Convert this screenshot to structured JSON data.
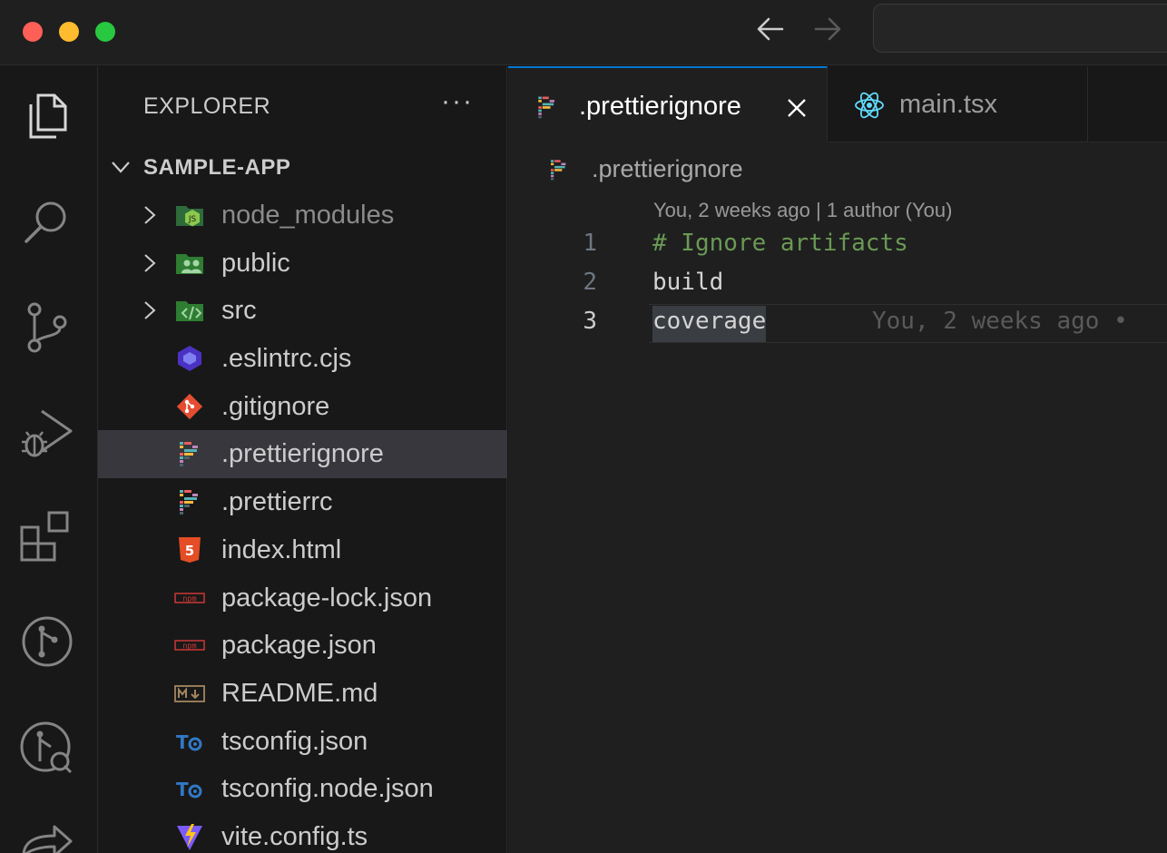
{
  "titlebar": {
    "back_icon": "arrow-left-icon",
    "forward_icon": "arrow-right-icon"
  },
  "activity_bar": [
    {
      "name": "explorer-icon"
    },
    {
      "name": "search-icon"
    },
    {
      "name": "source-control-icon"
    },
    {
      "name": "run-debug-icon"
    },
    {
      "name": "extensions-icon"
    },
    {
      "name": "git-graph-icon"
    },
    {
      "name": "timeline-icon"
    },
    {
      "name": "remote-icon"
    }
  ],
  "sidebar": {
    "title": "EXPLORER",
    "more": "···",
    "root": "SAMPLE-APP",
    "items": [
      {
        "label": "node_modules",
        "type": "folder",
        "icon": "node-folder-icon",
        "color": "#8cc84b",
        "dim": true
      },
      {
        "label": "public",
        "type": "folder",
        "icon": "public-folder-icon",
        "color": "#4caf50"
      },
      {
        "label": "src",
        "type": "folder",
        "icon": "src-folder-icon",
        "color": "#4caf50"
      },
      {
        "label": ".eslintrc.cjs",
        "type": "file",
        "icon": "eslint-icon",
        "color": "#4b32c3"
      },
      {
        "label": ".gitignore",
        "type": "file",
        "icon": "git-icon",
        "color": "#e44d31"
      },
      {
        "label": ".prettierignore",
        "type": "file",
        "icon": "prettier-icon",
        "selected": true
      },
      {
        "label": ".prettierrc",
        "type": "file",
        "icon": "prettier-icon"
      },
      {
        "label": "index.html",
        "type": "file",
        "icon": "html5-icon",
        "color": "#e44d26"
      },
      {
        "label": "package-lock.json",
        "type": "file",
        "icon": "npm-icon",
        "color": "#cb3837"
      },
      {
        "label": "package.json",
        "type": "file",
        "icon": "npm-icon",
        "color": "#cb3837"
      },
      {
        "label": "README.md",
        "type": "file",
        "icon": "markdown-icon",
        "color": "#a38560"
      },
      {
        "label": "tsconfig.json",
        "type": "file",
        "icon": "tsconfig-icon",
        "color": "#3178c6"
      },
      {
        "label": "tsconfig.node.json",
        "type": "file",
        "icon": "tsconfig-icon",
        "color": "#3178c6"
      },
      {
        "label": "vite.config.ts",
        "type": "file",
        "icon": "vite-icon",
        "color": "#bd34fe"
      }
    ]
  },
  "tabs": [
    {
      "label": ".prettierignore",
      "icon": "prettier-icon",
      "active": true
    },
    {
      "label": "main.tsx",
      "icon": "react-icon",
      "color": "#61dafb",
      "active": false
    }
  ],
  "breadcrumb": {
    "file": ".prettierignore"
  },
  "codelens": "You, 2 weeks ago | 1 author (You)",
  "code": [
    {
      "num": "1",
      "text": "# Ignore artifacts",
      "kind": "comment"
    },
    {
      "num": "2",
      "text": "build",
      "kind": "plain"
    },
    {
      "num": "3",
      "text": "coverage",
      "kind": "plain",
      "current": true,
      "blame": "You, 2 weeks ago •"
    }
  ]
}
